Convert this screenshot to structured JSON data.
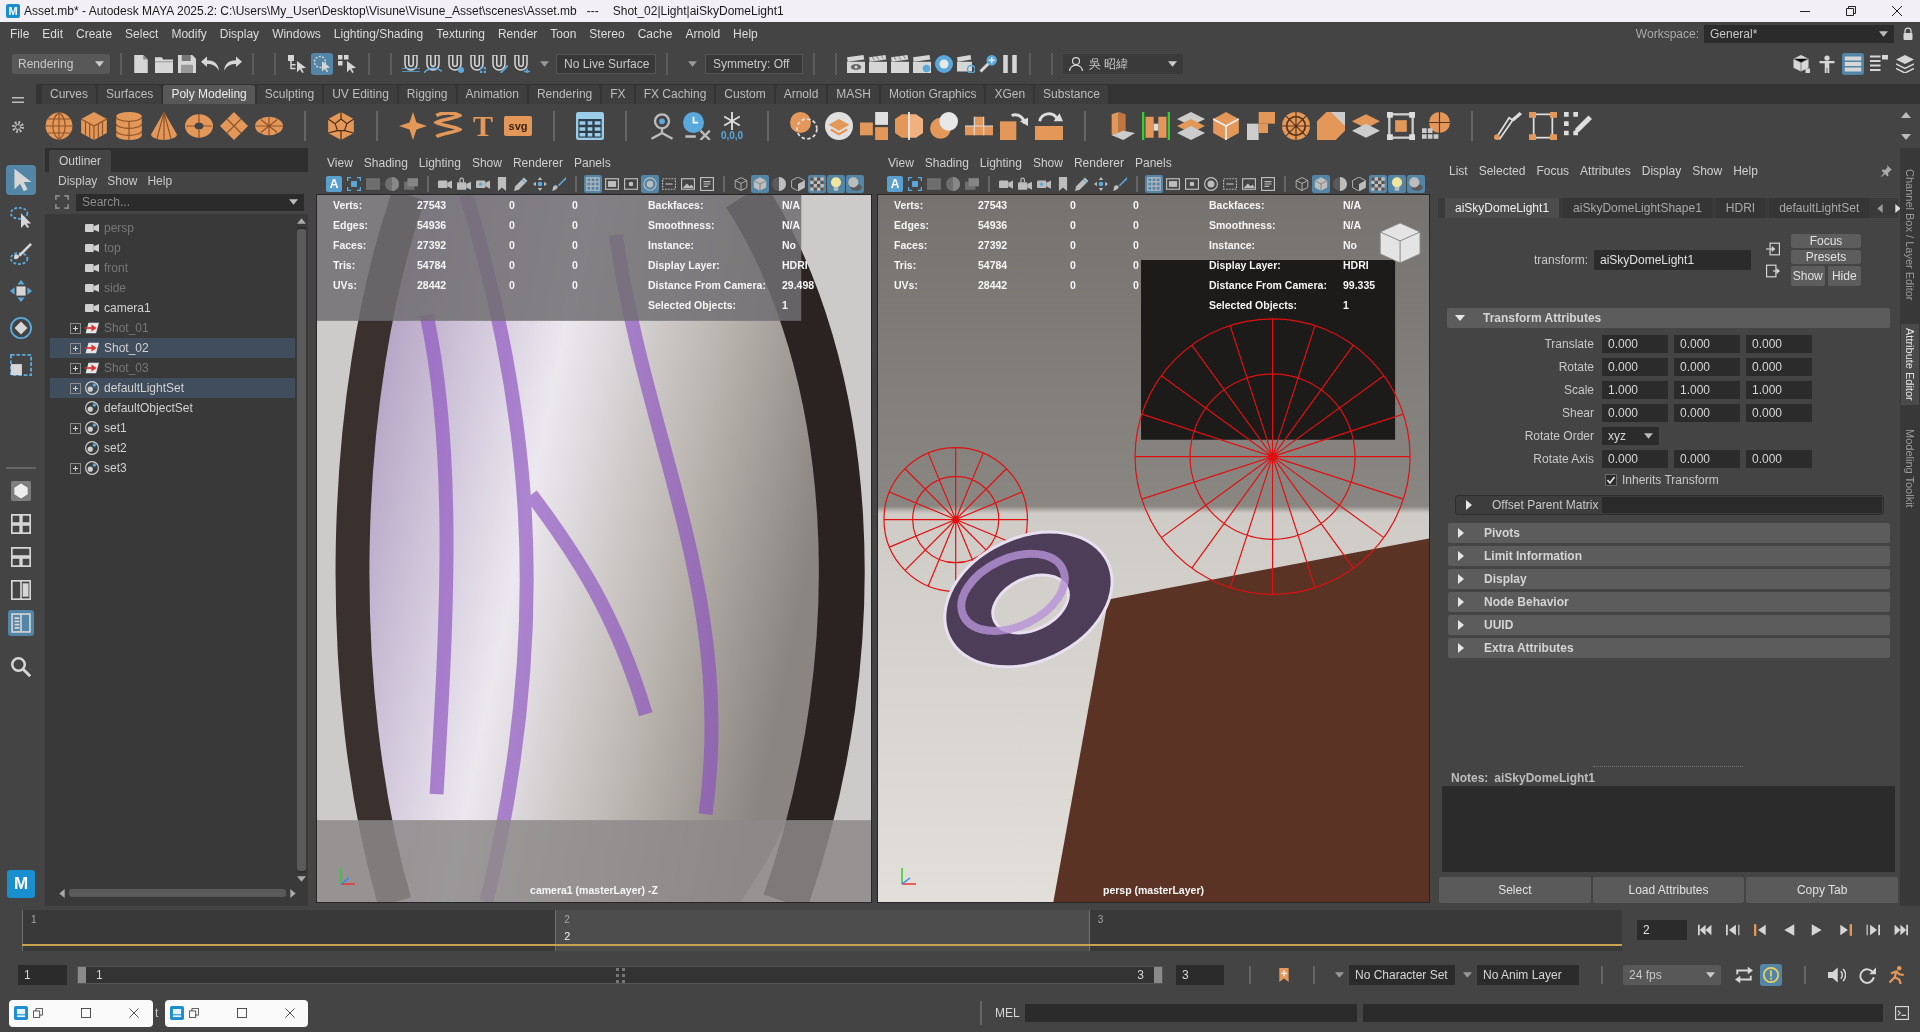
{
  "window": {
    "logo_letter": "M",
    "title": "Asset.mb* - Autodesk MAYA 2025.2: C:\\Users\\My_User\\Desktop\\Visune\\Visune_Asset\\scenes\\Asset.mb",
    "separator": "---",
    "node_path": "Shot_02|Light|aiSkyDomeLight1"
  },
  "menu_bar": {
    "items": [
      "File",
      "Edit",
      "Create",
      "Select",
      "Modify",
      "Display",
      "Windows",
      "Lighting/Shading",
      "Texturing",
      "Render",
      "Toon",
      "Stereo",
      "Cache",
      "Arnold",
      "Help"
    ],
    "workspace_label": "Workspace:",
    "workspace": "General*"
  },
  "status_line": {
    "menu_set": "Rendering",
    "selection_modes": [
      {
        "selected": false
      },
      {
        "selected": true
      },
      {
        "selected": false
      }
    ],
    "live_surface": "No Live Surface",
    "symmetry": "Symmetry: Off",
    "user": "吳 昭緯",
    "panel_toggles": [
      {
        "on": false
      },
      {
        "on": false
      },
      {
        "on": true
      },
      {
        "on": false
      },
      {
        "on": false
      }
    ]
  },
  "shelf": {
    "tabs": [
      {
        "label": "Curves",
        "selected": false
      },
      {
        "label": "Surfaces",
        "selected": false
      },
      {
        "label": "Poly Modeling",
        "selected": true
      },
      {
        "label": "Sculpting",
        "selected": false
      },
      {
        "label": "UV Editing",
        "selected": false
      },
      {
        "label": "Rigging",
        "selected": false
      },
      {
        "label": "Animation",
        "selected": false
      },
      {
        "label": "Rendering",
        "selected": false
      },
      {
        "label": "FX",
        "selected": false
      },
      {
        "label": "FX Caching",
        "selected": false
      },
      {
        "label": "Custom",
        "selected": false
      },
      {
        "label": "Arnold",
        "selected": false
      },
      {
        "label": "MASH",
        "selected": false
      },
      {
        "label": "Motion Graphics",
        "selected": false
      },
      {
        "label": "XGen",
        "selected": false
      },
      {
        "label": "Substance",
        "selected": false
      }
    ],
    "type_tool_letter": "T",
    "svg_tool_label": "svg",
    "snap_caption": "0,0,0"
  },
  "toolbox": {
    "tools": [
      {
        "selected": true
      },
      {
        "selected": false
      },
      {
        "selected": false
      },
      {
        "selected": false
      },
      {
        "selected": false
      },
      {
        "selected": false
      }
    ],
    "layouts": [
      {
        "selected": false
      },
      {
        "selected": false
      },
      {
        "selected": false
      },
      {
        "selected": false
      },
      {
        "selected": true
      }
    ],
    "logo_letter": "M"
  },
  "outliner": {
    "tab": "Outliner",
    "menus": [
      "Display",
      "Show",
      "Help"
    ],
    "search_placeholder": "Search...",
    "items": [
      {
        "label": "persp",
        "kind": "camera",
        "dimmed": true,
        "selected": false,
        "expandable": false
      },
      {
        "label": "top",
        "kind": "camera",
        "dimmed": true,
        "selected": false,
        "expandable": false
      },
      {
        "label": "front",
        "kind": "camera",
        "dimmed": true,
        "selected": false,
        "expandable": false
      },
      {
        "label": "side",
        "kind": "camera",
        "dimmed": true,
        "selected": false,
        "expandable": false
      },
      {
        "label": "camera1",
        "kind": "camera",
        "dimmed": false,
        "selected": false,
        "expandable": false
      },
      {
        "label": "Shot_01",
        "kind": "shot",
        "dimmed": true,
        "selected": false,
        "expandable": true
      },
      {
        "label": "Shot_02",
        "kind": "shot",
        "dimmed": false,
        "selected": true,
        "expandable": true
      },
      {
        "label": "Shot_03",
        "kind": "shot",
        "dimmed": true,
        "selected": false,
        "expandable": true
      },
      {
        "label": "defaultLightSet",
        "kind": "set",
        "dimmed": false,
        "selected": true,
        "expandable": true
      },
      {
        "label": "defaultObjectSet",
        "kind": "set",
        "dimmed": false,
        "selected": false,
        "expandable": false
      },
      {
        "label": "set1",
        "kind": "set",
        "dimmed": false,
        "selected": false,
        "expandable": true
      },
      {
        "label": "set2",
        "kind": "set",
        "dimmed": false,
        "selected": false,
        "expandable": false
      },
      {
        "label": "set3",
        "kind": "set",
        "dimmed": false,
        "selected": false,
        "expandable": true
      }
    ]
  },
  "viewports": [
    {
      "kind": "closeup",
      "menus": [
        "View",
        "Shading",
        "Lighting",
        "Show",
        "Renderer",
        "Panels"
      ],
      "isolate": {
        "letter": "A",
        "on": true
      },
      "toolbar": [
        {
          "on": false
        },
        {
          "on": false
        },
        {
          "on": false
        },
        {
          "on": false
        },
        {
          "on": false
        },
        {
          "on": false
        },
        {
          "on": false
        },
        {
          "on": false
        },
        {
          "on": false
        },
        {
          "on": false
        },
        {
          "on": false
        },
        {
          "on": true
        },
        {
          "on": false
        },
        {
          "on": false
        },
        {
          "on": true
        },
        {
          "on": false
        },
        {
          "on": false
        },
        {
          "on": false
        },
        {
          "on": false
        },
        {
          "on": true
        },
        {
          "on": false
        },
        {
          "on": false
        },
        {
          "on": true
        },
        {
          "on": true
        },
        {
          "on": true
        }
      ],
      "stats": [
        {
          "label": "Verts:",
          "values": [
            "27543",
            "0",
            "0"
          ]
        },
        {
          "label": "Edges:",
          "values": [
            "54936",
            "0",
            "0"
          ]
        },
        {
          "label": "Faces:",
          "values": [
            "27392",
            "0",
            "0"
          ]
        },
        {
          "label": "Tris:",
          "values": [
            "54784",
            "0",
            "0"
          ]
        },
        {
          "label": "UVs:",
          "values": [
            "28442",
            "0",
            "0"
          ]
        }
      ],
      "info": [
        {
          "label": "Backfaces:",
          "value": "N/A"
        },
        {
          "label": "Smoothness:",
          "value": "N/A"
        },
        {
          "label": "Instance:",
          "value": "No"
        },
        {
          "label": "Display Layer:",
          "value": "HDRI"
        },
        {
          "label": "Distance From Camera:",
          "value": "29.498"
        },
        {
          "label": "Selected Objects:",
          "value": "1"
        }
      ],
      "camera_label": "camera1 (masterLayer) -Z"
    },
    {
      "kind": "studio",
      "menus": [
        "View",
        "Shading",
        "Lighting",
        "Show",
        "Renderer",
        "Panels"
      ],
      "isolate": {
        "letter": "A",
        "on": true
      },
      "toolbar": [
        {
          "on": false
        },
        {
          "on": false
        },
        {
          "on": false
        },
        {
          "on": false
        },
        {
          "on": false
        },
        {
          "on": false
        },
        {
          "on": false
        },
        {
          "on": false
        },
        {
          "on": false
        },
        {
          "on": false
        },
        {
          "on": false
        },
        {
          "on": true
        },
        {
          "on": false
        },
        {
          "on": false
        },
        {
          "on": false
        },
        {
          "on": false
        },
        {
          "on": false
        },
        {
          "on": false
        },
        {
          "on": false
        },
        {
          "on": true
        },
        {
          "on": false
        },
        {
          "on": false
        },
        {
          "on": true
        },
        {
          "on": true
        },
        {
          "on": true
        }
      ],
      "stats": [
        {
          "label": "Verts:",
          "values": [
            "27543",
            "0",
            "0"
          ]
        },
        {
          "label": "Edges:",
          "values": [
            "54936",
            "0",
            "0"
          ]
        },
        {
          "label": "Faces:",
          "values": [
            "27392",
            "0",
            "0"
          ]
        },
        {
          "label": "Tris:",
          "values": [
            "54784",
            "0",
            "0"
          ]
        },
        {
          "label": "UVs:",
          "values": [
            "28442",
            "0",
            "0"
          ]
        }
      ],
      "info": [
        {
          "label": "Backfaces:",
          "value": "N/A"
        },
        {
          "label": "Smoothness:",
          "value": "N/A"
        },
        {
          "label": "Instance:",
          "value": "No"
        },
        {
          "label": "Display Layer:",
          "value": "HDRI"
        },
        {
          "label": "Distance From Camera:",
          "value": "99.335"
        },
        {
          "label": "Selected Objects:",
          "value": "1"
        }
      ],
      "camera_label": "persp (masterLayer)"
    }
  ],
  "attribute_editor": {
    "menus": [
      "List",
      "Selected",
      "Focus",
      "Attributes",
      "Display",
      "Show",
      "Help"
    ],
    "tabs": [
      {
        "label": "aiSkyDomeLight1",
        "selected": true
      },
      {
        "label": "aiSkyDomeLightShape1",
        "selected": false
      },
      {
        "label": "HDRI",
        "selected": false
      },
      {
        "label": "defaultLightSet",
        "selected": false
      }
    ],
    "node_type": "transform:",
    "node_name": "aiSkyDomeLight1",
    "buttons": [
      "Focus",
      "Presets"
    ],
    "show_hide": [
      "Show",
      "Hide"
    ],
    "sections": [
      {
        "title": "Transform Attributes",
        "expanded": true,
        "rows": [
          {
            "label": "Translate",
            "kind": "vector",
            "values": [
              "0.000",
              "0.000",
              "0.000"
            ]
          },
          {
            "label": "Rotate",
            "kind": "vector",
            "values": [
              "0.000",
              "0.000",
              "0.000"
            ]
          },
          {
            "label": "Scale",
            "kind": "vector",
            "values": [
              "1.000",
              "1.000",
              "1.000"
            ]
          },
          {
            "label": "Shear",
            "kind": "vector",
            "values": [
              "0.000",
              "0.000",
              "0.000"
            ]
          },
          {
            "label": "Rotate Order",
            "kind": "dropdown",
            "value": "xyz"
          },
          {
            "label": "Rotate Axis",
            "kind": "vector",
            "values": [
              "0.000",
              "0.000",
              "0.000"
            ]
          }
        ],
        "checkbox": {
          "label": "Inherits Transform",
          "checked": true
        },
        "subsections": [
          {
            "title": "Offset Parent Matrix",
            "expanded": false
          }
        ]
      },
      {
        "title": "Pivots",
        "expanded": false
      },
      {
        "title": "Limit Information",
        "expanded": false
      },
      {
        "title": "Display",
        "expanded": false
      },
      {
        "title": "Node Behavior",
        "expanded": false
      },
      {
        "title": "UUID",
        "expanded": false
      },
      {
        "title": "Extra Attributes",
        "expanded": false
      }
    ],
    "notes_label": "Notes:",
    "notes_node": "aiSkyDomeLight1",
    "bottom_buttons": [
      "Select",
      "Load Attributes",
      "Copy Tab"
    ]
  },
  "side_tabs": [
    {
      "label": "Channel Box / Layer Editor",
      "selected": false
    },
    {
      "label": "Attribute Editor",
      "selected": true
    },
    {
      "label": "Modeling Toolkit",
      "selected": false
    }
  ],
  "time_slider": {
    "frames": [
      {
        "label": "1",
        "selected": false
      },
      {
        "label": "2",
        "selected": true
      },
      {
        "label": "3",
        "selected": false
      }
    ],
    "current_label": "2",
    "current_frame": "2"
  },
  "range_slider": {
    "start": "1",
    "range_start": "1",
    "range_end": "3",
    "end": "3",
    "character_set": "No Character Set",
    "anim_layer": "No Anim Layer",
    "fps": "24 fps",
    "playback_toggles": [
      {
        "on": false
      },
      {
        "on": true
      }
    ]
  },
  "command_line": {
    "help_text": "t",
    "language": "MEL"
  }
}
